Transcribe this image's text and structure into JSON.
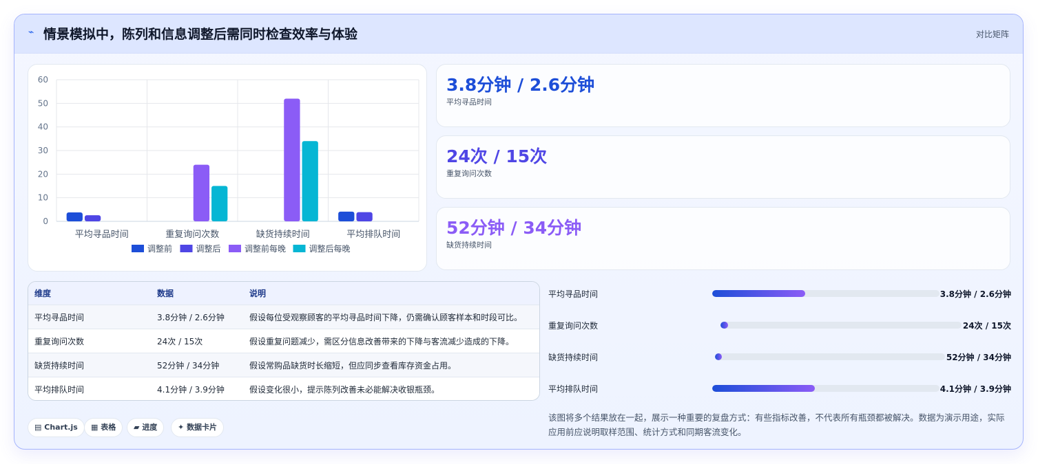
{
  "header": {
    "icon": "pulse-icon",
    "title": "情景模拟中，陈列和信息调整后需同时检查效率与体验",
    "tag": "对比矩阵"
  },
  "chart_data": {
    "type": "bar",
    "categories": [
      "平均寻品时间",
      "重复询问次数",
      "缺货持续时间",
      "平均排队时间"
    ],
    "series": [
      {
        "name": "调整前",
        "color": "#1d4ed8",
        "values": [
          3.8,
          null,
          null,
          4.1
        ]
      },
      {
        "name": "调整后",
        "color": "#4f46e5",
        "values": [
          2.6,
          null,
          null,
          3.9
        ]
      },
      {
        "name": "调整前每晚",
        "color": "#8b5cf6",
        "values": [
          null,
          24,
          52,
          null
        ]
      },
      {
        "name": "调整后每晚",
        "color": "#06b6d4",
        "values": [
          null,
          15,
          34,
          null
        ]
      }
    ],
    "ylim": [
      0,
      60
    ],
    "yticks": [
      "0",
      "10",
      "20",
      "30",
      "40",
      "50",
      "60"
    ],
    "legend_position": "bottom",
    "grid": true
  },
  "stats": [
    {
      "value": "3.8分钟 / 2.6分钟",
      "label": "平均寻品时间",
      "color": "#1d4ed8"
    },
    {
      "value": "24次 / 15次",
      "label": "重复询问次数",
      "color": "#4f46e5"
    },
    {
      "value": "52分钟 / 34分钟",
      "label": "缺货持续时间",
      "color": "#8b5cf6"
    }
  ],
  "table": {
    "headers": [
      "维度",
      "数据",
      "说明"
    ],
    "rows": [
      [
        "平均寻品时间",
        "3.8分钟 / 2.6分钟",
        "假设每位受观察顾客的平均寻品时间下降，仍需确认顾客样本和时段可比。"
      ],
      [
        "重复询问次数",
        "24次 / 15次",
        "假设重复问题减少，需区分信息改善带来的下降与客流减少造成的下降。"
      ],
      [
        "缺货持续时间",
        "52分钟 / 34分钟",
        "假设常购品缺货时长缩短，但应同步查看库存资金占用。"
      ],
      [
        "平均排队时间",
        "4.1分钟 / 3.9分钟",
        "假设变化很小，提示陈列改善未必能解决收银瓶颈。"
      ]
    ]
  },
  "progress": [
    {
      "label": "平均寻品时间",
      "value": "3.8分钟 / 2.6分钟",
      "fraction": 0.41
    },
    {
      "label": "重复询问次数",
      "value": "24次 / 15次",
      "fraction": 0.03
    },
    {
      "label": "缺货持续时间",
      "value": "52分钟 / 34分钟",
      "fraction": 0.03
    },
    {
      "label": "平均排队时间",
      "value": "4.1分钟 / 3.9分钟",
      "fraction": 0.45
    }
  ],
  "pills": [
    {
      "icon": "chart-icon",
      "glyph": "▤",
      "label": "Chart.js"
    },
    {
      "icon": "table-icon",
      "glyph": "▦",
      "label": "表格"
    },
    {
      "icon": "progress-icon",
      "glyph": "▰",
      "label": "进度"
    },
    {
      "icon": "sparkle-icon",
      "glyph": "✦",
      "label": "数据卡片"
    }
  ],
  "note": "该图将多个结果放在一起，展示一种重要的复盘方式：有些指标改善，不代表所有瓶颈都被解决。数据为演示用途，实际应用前应说明取样范围、统计方式和同期客流变化。"
}
